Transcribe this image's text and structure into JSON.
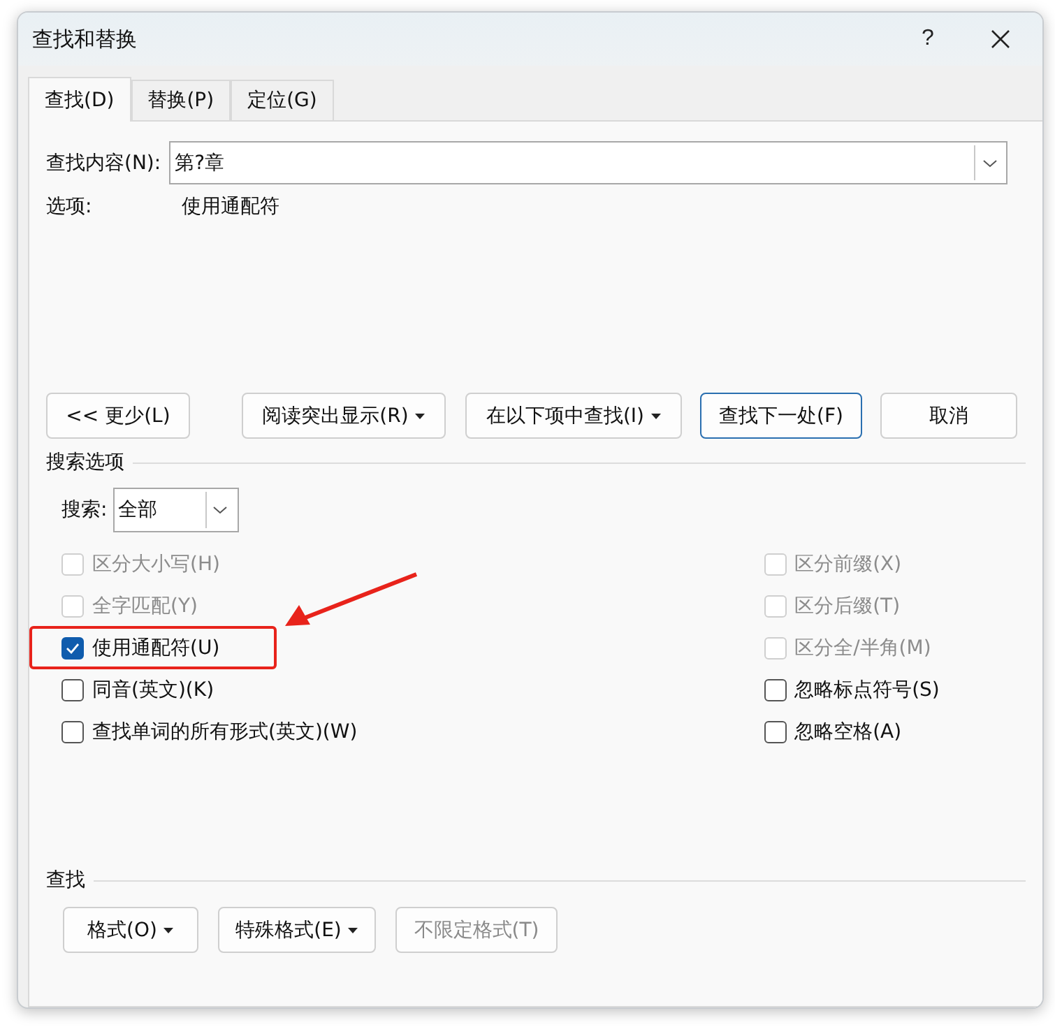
{
  "window": {
    "title": "查找和替换",
    "help": "?"
  },
  "tabs": [
    {
      "label": "查找(D)",
      "selected": true
    },
    {
      "label": "替换(P)",
      "selected": false
    },
    {
      "label": "定位(G)",
      "selected": false
    }
  ],
  "find": {
    "label": "查找内容(N):",
    "value": "第?章"
  },
  "options_line": {
    "label": "选项:",
    "value": "使用通配符"
  },
  "buttons": [
    {
      "label": "<< 更少(L)",
      "menu": false,
      "default": false,
      "disabled": false
    },
    {
      "label": "阅读突出显示(R)",
      "menu": true,
      "default": false,
      "disabled": false
    },
    {
      "label": "在以下项中查找(I)",
      "menu": true,
      "default": false,
      "disabled": false
    },
    {
      "label": "查找下一处(F)",
      "menu": false,
      "default": true,
      "disabled": false
    },
    {
      "label": "取消",
      "menu": false,
      "default": false,
      "disabled": false
    }
  ],
  "search_options": {
    "title": "搜索选项",
    "search_label": "搜索:",
    "search_value": "全部",
    "left": [
      {
        "label": "区分大小写(H)",
        "checked": false,
        "disabled": true,
        "annotated": false
      },
      {
        "label": "全字匹配(Y)",
        "checked": false,
        "disabled": true,
        "annotated": false
      },
      {
        "label": "使用通配符(U)",
        "checked": true,
        "disabled": false,
        "annotated": true
      },
      {
        "label": "同音(英文)(K)",
        "checked": false,
        "disabled": false,
        "annotated": false
      },
      {
        "label": "查找单词的所有形式(英文)(W)",
        "checked": false,
        "disabled": false,
        "annotated": false
      }
    ],
    "right": [
      {
        "label": "区分前缀(X)",
        "checked": false,
        "disabled": true,
        "annotated": false
      },
      {
        "label": "区分后缀(T)",
        "checked": false,
        "disabled": true,
        "annotated": false
      },
      {
        "label": "区分全/半角(M)",
        "checked": false,
        "disabled": true,
        "annotated": false
      },
      {
        "label": "忽略标点符号(S)",
        "checked": false,
        "disabled": false,
        "annotated": false
      },
      {
        "label": "忽略空格(A)",
        "checked": false,
        "disabled": false,
        "annotated": false
      }
    ]
  },
  "find_section": {
    "title": "查找",
    "buttons": [
      {
        "label": "格式(O)",
        "menu": true,
        "default": false,
        "disabled": false
      },
      {
        "label": "特殊格式(E)",
        "menu": true,
        "default": false,
        "disabled": false
      },
      {
        "label": "不限定格式(T)",
        "menu": false,
        "default": false,
        "disabled": true
      }
    ]
  }
}
